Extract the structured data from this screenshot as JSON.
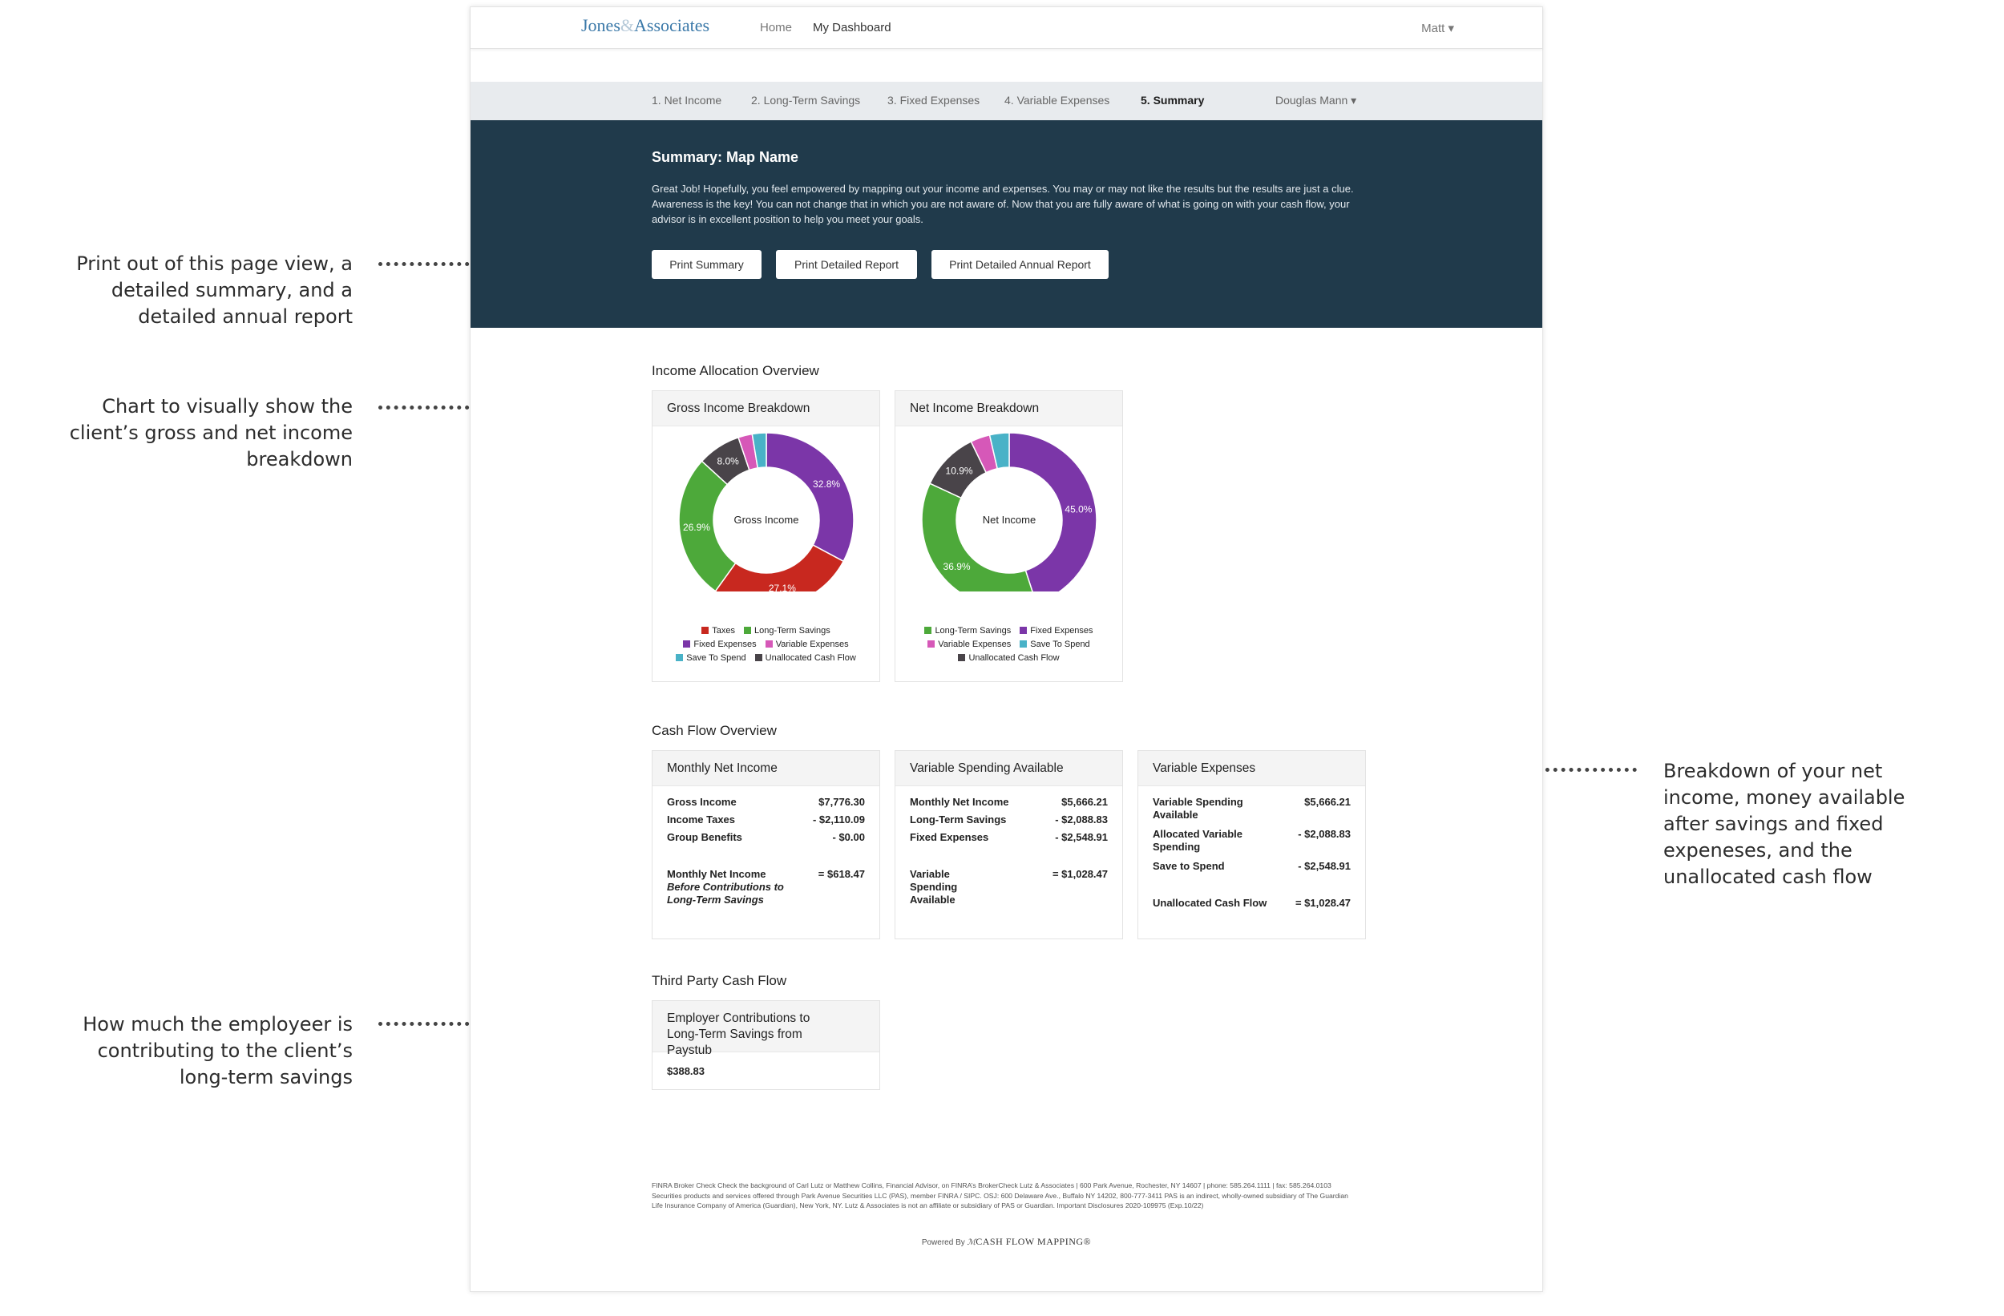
{
  "annotations": {
    "print": [
      "Print out of this page view, a",
      "detailed summary, and a",
      "detailed annual report"
    ],
    "chart": [
      "Chart to visually show the",
      "client’s gross and net income",
      "breakdown"
    ],
    "breakdown": [
      "Breakdown of your net",
      "income, money available",
      "after savings and fixed",
      "expeneses, and the",
      "unallocated cash flow"
    ],
    "employer": [
      "How much the employeer is",
      "contributing to the client’s",
      "long-term savings"
    ]
  },
  "topnav": {
    "logo_left": "Jones",
    "logo_amp": "&",
    "logo_right": "Associates",
    "home": "Home",
    "dashboard": "My Dashboard",
    "user": "Matt ▾"
  },
  "steps": [
    "1. Net Income",
    "2. Long-Term Savings",
    "3. Fixed Expenses",
    "4. Variable Expenses",
    "5. Summary"
  ],
  "client_selector": "Douglas Mann ▾",
  "hero": {
    "title": "Summary: Map Name",
    "text": "Great Job! Hopefully, you feel empowered by mapping out your income and expenses. You may or may not like the results but the results are just a clue. Awareness is the key! You can not change that in which you are not aware of. Now that you are fully aware of what is going on with your cash flow, your advisor is in excellent position to help you meet your goals.",
    "buttons": [
      "Print Summary",
      "Print Detailed Report",
      "Print Detailed Annual Report"
    ]
  },
  "income_section": "Income Allocation Overview",
  "colors": {
    "taxes": "#c8281f",
    "long_term": "#4da93a",
    "fixed": "#7b36a8",
    "variable": "#d658b8",
    "save": "#49b2c7",
    "unallocated": "#494449"
  },
  "chart_data": [
    {
      "type": "pie",
      "title": "Gross Income Breakdown",
      "center_label": "Gross Income",
      "series": [
        {
          "name": "Fixed Expenses",
          "value": 32.8,
          "color": "#7b36a8",
          "label": "32.8%"
        },
        {
          "name": "Taxes",
          "value": 27.1,
          "color": "#c8281f",
          "label": "27.1%"
        },
        {
          "name": "Long-Term Savings",
          "value": 26.9,
          "color": "#4da93a",
          "label": "26.9%"
        },
        {
          "name": "Unallocated Cash Flow",
          "value": 8.0,
          "color": "#494449",
          "label": "8.0%"
        },
        {
          "name": "Variable Expenses",
          "value": 2.6,
          "color": "#d658b8",
          "label": ""
        },
        {
          "name": "Save To Spend",
          "value": 2.6,
          "color": "#49b2c7",
          "label": ""
        }
      ],
      "legend": [
        "Taxes",
        "Long-Term Savings",
        "Fixed Expenses",
        "Variable Expenses",
        "Save To Spend",
        "Unallocated Cash Flow"
      ]
    },
    {
      "type": "pie",
      "title": "Net Income Breakdown",
      "center_label": "Net Income",
      "series": [
        {
          "name": "Fixed Expenses",
          "value": 45.0,
          "color": "#7b36a8",
          "label": "45.0%"
        },
        {
          "name": "Long-Term Savings",
          "value": 36.9,
          "color": "#4da93a",
          "label": "36.9%"
        },
        {
          "name": "Unallocated Cash Flow",
          "value": 10.9,
          "color": "#494449",
          "label": "10.9%"
        },
        {
          "name": "Variable Expenses",
          "value": 3.6,
          "color": "#d658b8",
          "label": ""
        },
        {
          "name": "Save To Spend",
          "value": 3.6,
          "color": "#49b2c7",
          "label": ""
        }
      ],
      "legend": [
        "Long-Term Savings",
        "Fixed Expenses",
        "Variable Expenses",
        "Save To Spend",
        "Unallocated Cash Flow"
      ]
    }
  ],
  "cashflow_section": "Cash Flow Overview",
  "cards": {
    "monthly": {
      "title": "Monthly Net Income",
      "rows": [
        {
          "label": "Gross Income",
          "value": "$7,776.30"
        },
        {
          "label": "Income Taxes",
          "value": "- $2,110.09"
        },
        {
          "label": "Group Benefits",
          "value": "- $0.00"
        }
      ],
      "total_label": "Monthly Net Income",
      "total_sub": "Before Contributions to Long-Term Savings",
      "total_value": "= $618.47"
    },
    "variable_available": {
      "title": "Variable Spending Available",
      "rows": [
        {
          "label": "Monthly Net Income",
          "value": "$5,666.21"
        },
        {
          "label": "Long-Term Savings",
          "value": "- $2,088.83"
        },
        {
          "label": "Fixed Expenses",
          "value": "- $2,548.91"
        }
      ],
      "total_label": "Variable Spending Available",
      "total_value": "= $1,028.47"
    },
    "variable_expenses": {
      "title": "Variable Expenses",
      "rows": [
        {
          "label": "Variable Spending Available",
          "value": "$5,666.21"
        },
        {
          "label": "Allocated Variable Spending",
          "value": "- $2,088.83"
        },
        {
          "label": "Save to Spend",
          "value": "- $2,548.91"
        }
      ],
      "total_label": "Unallocated Cash Flow",
      "total_value": "= $1,028.47"
    }
  },
  "third_party_section": "Third Party Cash Flow",
  "employer": {
    "title": "Employer Contributions to Long-Term Savings from Paystub",
    "value": "$388.83"
  },
  "footer": {
    "disclaimer": "FINRA Broker Check Check the background of Carl Lutz or Matthew Collins, Financial Advisor, on FINRA’s BrokerCheck Lutz & Associates | 600 Park Avenue, Rochester, NY 14607 | phone: 585.264.1111 | fax: 585.264.0103 Securities products and services offered through Park Avenue Securities LLC (PAS), member FINRA / SIPC. OSJ: 600 Delaware Ave., Buffalo NY 14202, 800-777-3411 PAS is an indirect, wholly-owned subsidiary of The Guardian Life Insurance Company of America (Guardian), New York, NY. Lutz & Associates is not an affiliate or subsidiary of PAS or Guardian. Important Disclosures 2020-109975 (Exp.10/22)",
    "powered_by": "Powered By",
    "brand": "CASH FLOW MAPPING®"
  }
}
